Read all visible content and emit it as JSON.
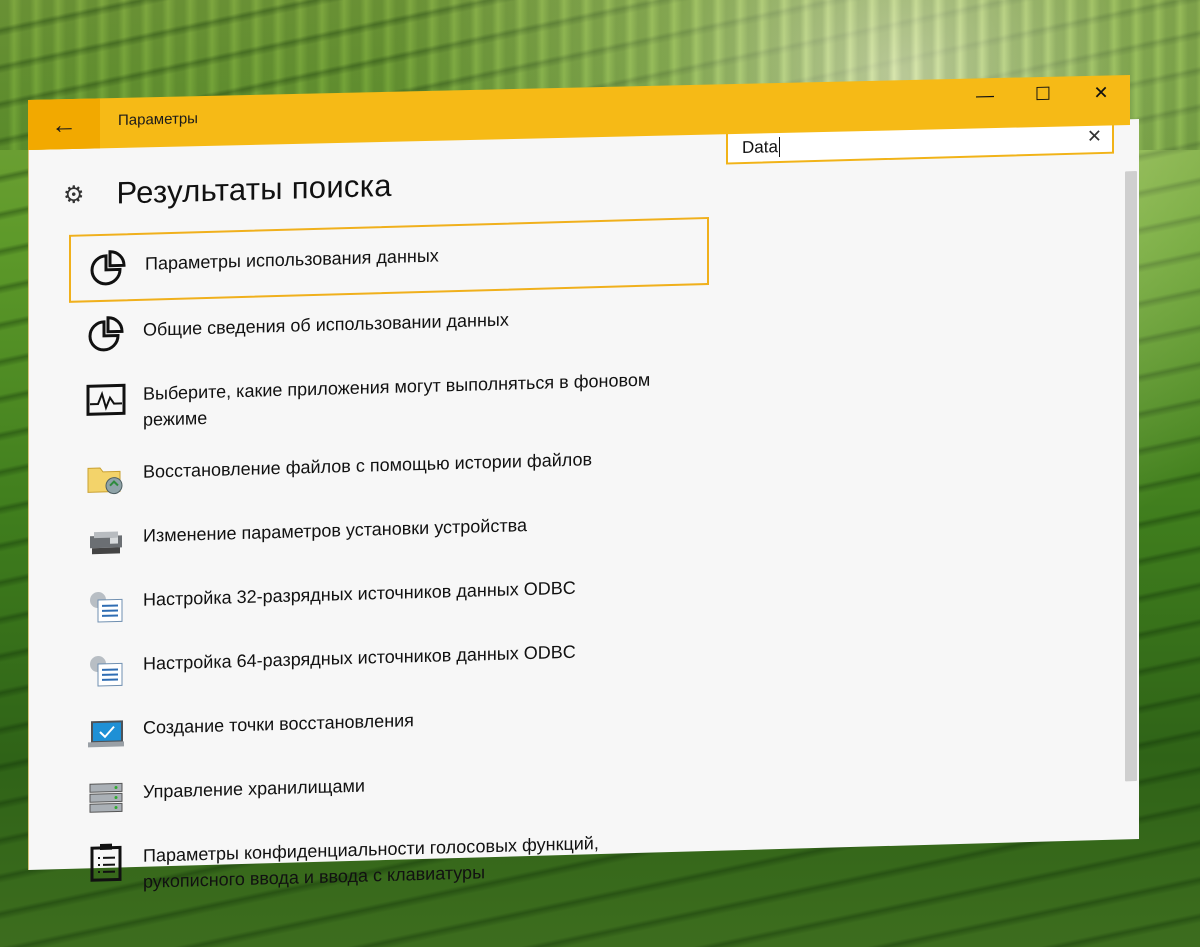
{
  "window": {
    "title": "Параметры",
    "back_glyph": "←",
    "controls": {
      "minimize": "—",
      "maximize": "☐",
      "close": "✕"
    }
  },
  "search": {
    "value": "Data",
    "clear": "✕"
  },
  "page": {
    "title": "Результаты поиска"
  },
  "results": [
    {
      "label": "Параметры использования данных",
      "icon": "pie-chart-icon",
      "selected": true
    },
    {
      "label": "Общие сведения об использовании данных",
      "icon": "pie-chart-icon"
    },
    {
      "label": "Выберите, какие приложения могут выполняться в фоновом режиме",
      "icon": "activity-monitor-icon"
    },
    {
      "label": "Восстановление файлов с помощью истории файлов",
      "icon": "file-history-icon"
    },
    {
      "label": "Изменение параметров установки устройства",
      "icon": "device-installation-icon"
    },
    {
      "label": "Настройка 32-разрядных источников данных ODBC",
      "icon": "odbc-settings-icon"
    },
    {
      "label": "Настройка 64-разрядных источников данных ODBC",
      "icon": "odbc-settings-icon"
    },
    {
      "label": "Создание точки восстановления",
      "icon": "system-restore-icon"
    },
    {
      "label": "Управление хранилищами",
      "icon": "storage-spaces-icon"
    },
    {
      "label": "Параметры конфиденциальности голосовых функций, рукописного ввода и ввода с клавиатуры",
      "icon": "clipboard-checklist-icon"
    }
  ],
  "colors": {
    "accent": "#f6ba16",
    "accent_dark": "#f2a900",
    "background": "#f7f7f7"
  }
}
